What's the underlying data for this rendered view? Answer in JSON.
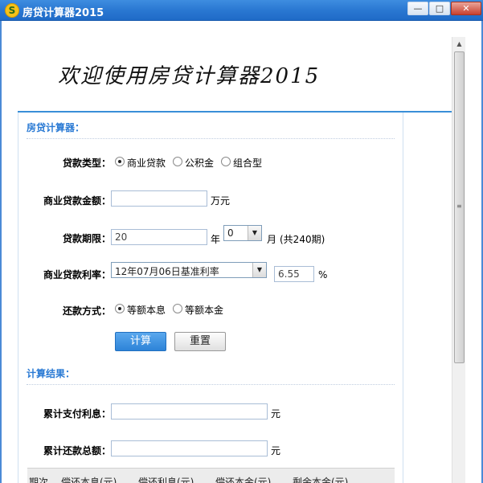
{
  "window": {
    "title": "房贷计算器2015",
    "icon_symbol": "S",
    "minimize": "—",
    "maximize": "□",
    "close": "✕"
  },
  "banner": {
    "text": "欢迎使用房贷计算器2015"
  },
  "calculator": {
    "section_title": "房贷计算器：",
    "loan_type": {
      "label": "贷款类型：",
      "options": [
        "商业贷款",
        "公积金",
        "组合型"
      ],
      "selected": "商业贷款"
    },
    "amount": {
      "label": "商业贷款金额：",
      "value": "",
      "unit": "万元"
    },
    "term": {
      "label": "贷款期限：",
      "years_value": "20",
      "years_unit": "年",
      "months_value": "0",
      "months_unit": "月",
      "total": "(共240期)"
    },
    "rate": {
      "label": "商业贷款利率：",
      "selected_option": "12年07月06日基准利率",
      "value": "6.55",
      "unit": "%"
    },
    "repayment": {
      "label": "还款方式：",
      "options": [
        "等额本息",
        "等额本金"
      ],
      "selected": "等额本息"
    },
    "buttons": {
      "calculate": "计算",
      "reset": "重置"
    }
  },
  "results": {
    "section_title": "计算结果：",
    "total_interest": {
      "label": "累计支付利息：",
      "value": "",
      "unit": "元"
    },
    "total_repayment": {
      "label": "累计还款总额：",
      "value": "",
      "unit": "元"
    },
    "table_headers": [
      "期次",
      "偿还本息(元)",
      "偿还利息(元)",
      "偿还本金(元)",
      "剩余本金(元)"
    ]
  }
}
